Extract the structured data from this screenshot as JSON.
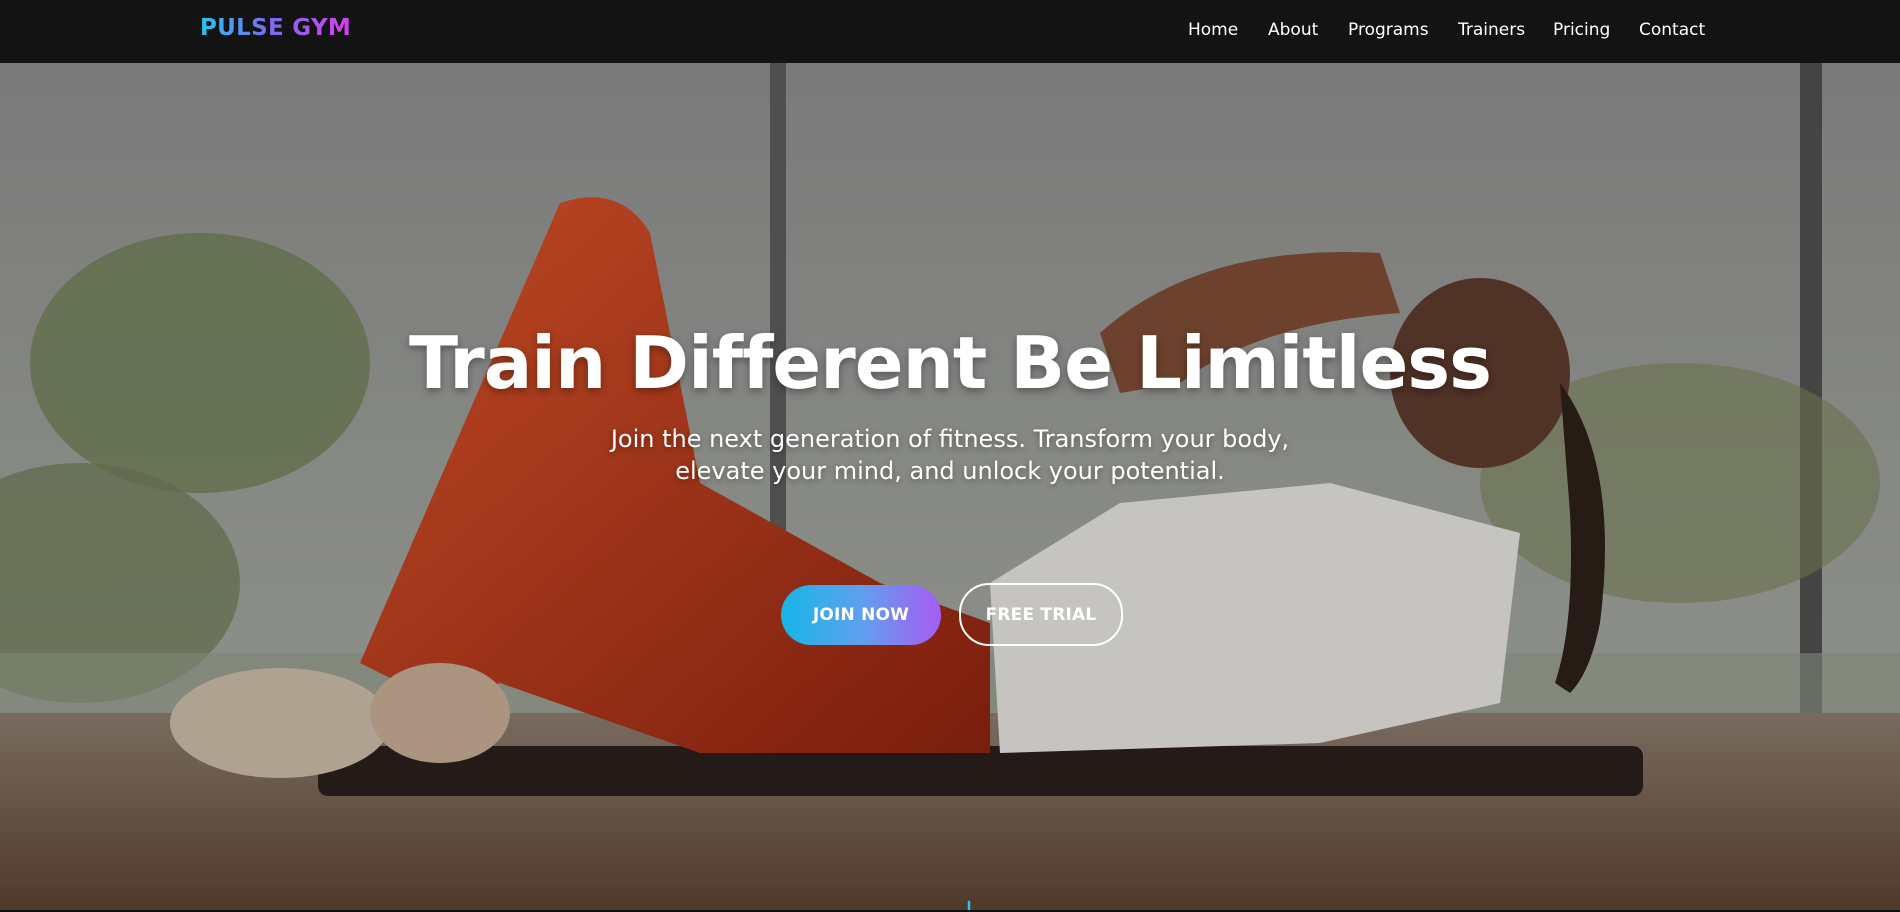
{
  "brand": {
    "logo_text": "PULSE GYM",
    "gradient": [
      "#22c8f0",
      "#7b6cf2",
      "#d63ef0"
    ]
  },
  "nav": {
    "items": [
      {
        "label": "Home"
      },
      {
        "label": "About"
      },
      {
        "label": "Programs"
      },
      {
        "label": "Trainers"
      },
      {
        "label": "Pricing"
      },
      {
        "label": "Contact"
      }
    ]
  },
  "hero": {
    "title": "Train Different Be Limitless",
    "subtitle_line1": "Join the next generation of fitness. Transform your body,",
    "subtitle_line2": "elevate your mind, and unlock your potential.",
    "primary_button": "JOIN NOW",
    "secondary_button": "FREE TRIAL",
    "scroll_icon": "arrow-down-icon",
    "accent_color": "#22c8f0"
  }
}
